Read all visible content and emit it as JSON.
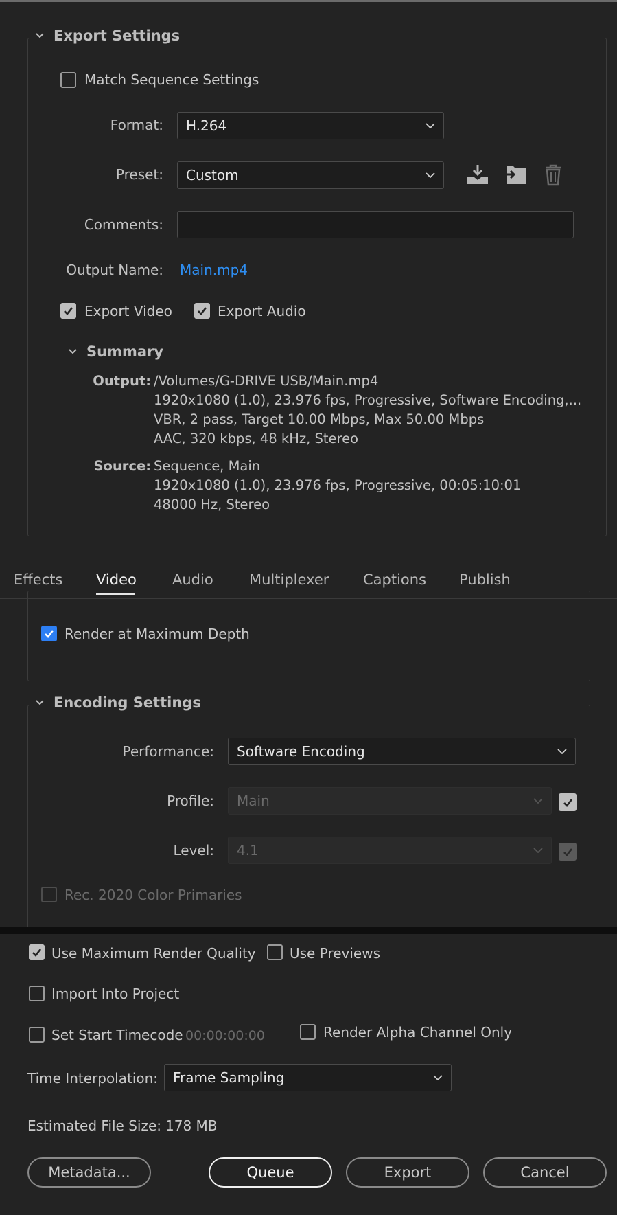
{
  "export_settings": {
    "title": "Export Settings",
    "match_sequence_label": "Match Sequence Settings",
    "match_sequence_checked": false,
    "format_label": "Format:",
    "format_value": "H.264",
    "preset_label": "Preset:",
    "preset_value": "Custom",
    "preset_icons": [
      "save-preset-icon",
      "import-preset-icon",
      "delete-preset-icon"
    ],
    "comments_label": "Comments:",
    "comments_value": "",
    "output_name_label": "Output Name:",
    "output_name_value": "Main.mp4",
    "export_video_label": "Export Video",
    "export_video_checked": true,
    "export_audio_label": "Export Audio",
    "export_audio_checked": true
  },
  "summary": {
    "title": "Summary",
    "output_key": "Output:",
    "output_lines": [
      "/Volumes/G-DRIVE USB/Main.mp4",
      "1920x1080 (1.0), 23.976 fps, Progressive, Software Encoding,...",
      "VBR, 2 pass, Target 10.00 Mbps, Max 50.00 Mbps",
      "AAC, 320 kbps, 48 kHz, Stereo"
    ],
    "source_key": "Source:",
    "source_lines": [
      "Sequence, Main",
      "1920x1080 (1.0), 23.976 fps, Progressive, 00:05:10:01",
      "48000 Hz, Stereo"
    ]
  },
  "tabs": [
    "Effects",
    "Video",
    "Audio",
    "Multiplexer",
    "Captions",
    "Publish"
  ],
  "active_tab": "Video",
  "video": {
    "render_max_depth_label": "Render at Maximum Depth",
    "render_max_depth_checked": true
  },
  "encoding": {
    "title": "Encoding Settings",
    "performance_label": "Performance:",
    "performance_value": "Software Encoding",
    "profile_label": "Profile:",
    "profile_value": "Main",
    "profile_checked": true,
    "level_label": "Level:",
    "level_value": "4.1",
    "level_checked": true,
    "rec2020_label": "Rec. 2020 Color Primaries",
    "rec2020_checked": false
  },
  "bottom": {
    "max_render_quality_label": "Use Maximum Render Quality",
    "max_render_quality_checked": true,
    "use_previews_label": "Use Previews",
    "use_previews_checked": false,
    "import_label": "Import Into Project",
    "import_checked": false,
    "start_timecode_label": "Set Start Timecode",
    "start_timecode_checked": false,
    "start_timecode_value": "00:00:00:00",
    "alpha_only_label": "Render Alpha Channel Only",
    "alpha_only_checked": false,
    "time_interp_label": "Time Interpolation:",
    "time_interp_value": "Frame Sampling",
    "file_size_label": "Estimated File Size:",
    "file_size_value": "178 MB"
  },
  "buttons": {
    "metadata": "Metadata...",
    "queue": "Queue",
    "export": "Export",
    "cancel": "Cancel"
  },
  "colors": {
    "background": "#232323",
    "accent_blue": "#2e8ef2",
    "checkbox_blue": "#2d7ff4"
  }
}
